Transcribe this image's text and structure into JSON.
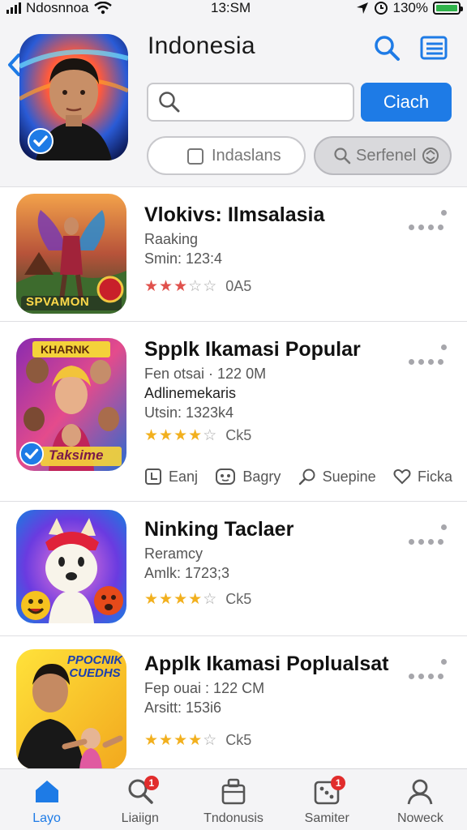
{
  "status_bar": {
    "carrier": "Ndosnnoa",
    "time": "13:SM",
    "battery": "130%"
  },
  "header": {
    "title": "Indonesia",
    "search_placeholder": "",
    "search_button": "Ciach",
    "filter_a": "Indaslans",
    "filter_b": "Serfenel"
  },
  "apps": [
    {
      "title": "Vlokivs: Ilmsalasia",
      "line1": "Raaking",
      "line2": "Smin: 123:4",
      "rating": 3,
      "rating_label": "0A5",
      "thumb_caption": "SPVAMON"
    },
    {
      "title": "Spplk Ikamasi Popular",
      "line1": "Fen otsai · 122 0M",
      "line2": "Adlinemekaris",
      "line3": "Utsin: 1323k4",
      "rating": 4,
      "rating_label": "Ck5",
      "thumb_caption_top": "KHARNK",
      "thumb_caption_bottom": "Taksime",
      "actions": [
        "Eanj",
        "Bagry",
        "Suepine",
        "Ficka"
      ]
    },
    {
      "title": "Ninking Taclaer",
      "line1": "Reramcy",
      "line2": "Amlk: 1723;3",
      "rating": 4,
      "rating_label": "Ck5"
    },
    {
      "title": "Applk Ikamasi Poplualsat",
      "line1": "Fep ouai : 122 CM",
      "line2": "Arsitt: 153i6",
      "rating": 4,
      "rating_label": "Ck5",
      "thumb_caption": "PPOCNIK CUEDHS"
    }
  ],
  "tabs": [
    {
      "label": "Layo",
      "icon": "home-icon",
      "active": true,
      "badge": ""
    },
    {
      "label": "Liaiign",
      "icon": "search-icon",
      "active": false,
      "badge": "1"
    },
    {
      "label": "Tndonusis",
      "icon": "bag-icon",
      "active": false,
      "badge": ""
    },
    {
      "label": "Samiter",
      "icon": "dice-icon",
      "active": false,
      "badge": "1"
    },
    {
      "label": "Noweck",
      "icon": "person-icon",
      "active": false,
      "badge": ""
    }
  ],
  "colors": {
    "accent": "#1e7be6",
    "star": "#f2b01e",
    "star_red": "#e0514c",
    "badge": "#e12c2c"
  }
}
